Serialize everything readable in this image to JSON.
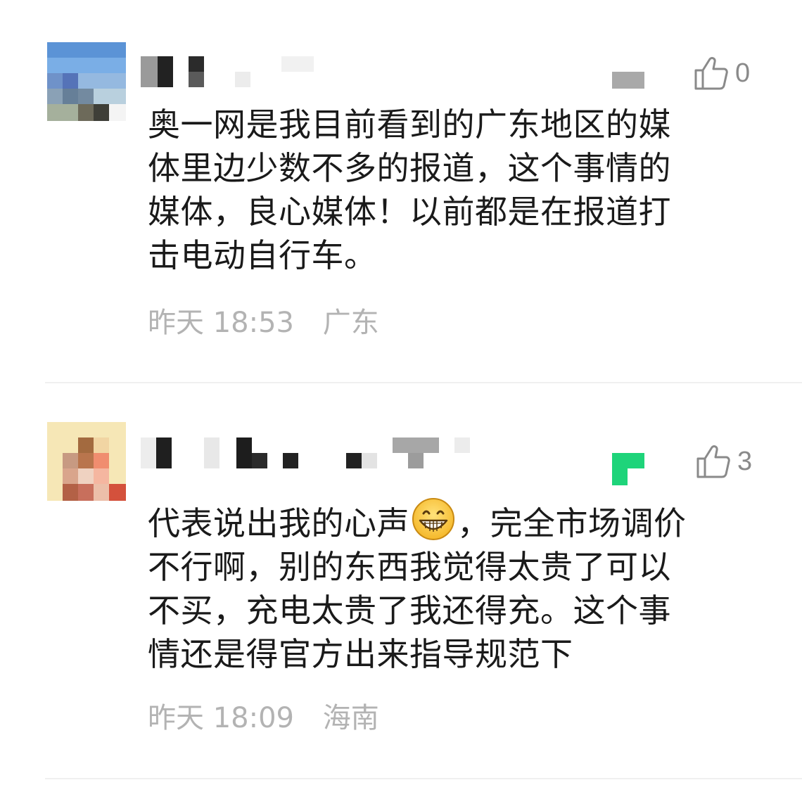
{
  "comments": [
    {
      "text": "奥一网是我目前看到的广东地区的媒体里边少数不多的报道，这个事情的媒体，良心媒体！以前都是在报道打击电动自行车。",
      "lines": [
        "奥一网是我目前看到的广东地区的媒",
        "体里边少数不多的报道，这个事情的",
        "媒体，良心媒体！以前都是在报道打",
        "击电动自行车。"
      ],
      "time": "昨天 18:53",
      "location": "广东",
      "likes": "0",
      "like_icon": "thumbs-up-icon"
    },
    {
      "text_before_emoji": "代表说出我的心声",
      "emoji": "grinning-face-emoji",
      "lines_after": [
        "，完全市场调价",
        "不行啊，别的东西我觉得太贵了可以",
        "不买，充电太贵了我还得充。这个事",
        "情还是得官方出来指导规范下"
      ],
      "time": "昨天 18:09",
      "location": "海南",
      "likes": "3",
      "like_icon": "thumbs-up-icon"
    }
  ],
  "colors": {
    "text": "#1a1a1a",
    "meta": "#b3b3b3",
    "like": "#8a8a8a",
    "divider": "#f0f0f0",
    "badge_green": "#1ed47a"
  }
}
